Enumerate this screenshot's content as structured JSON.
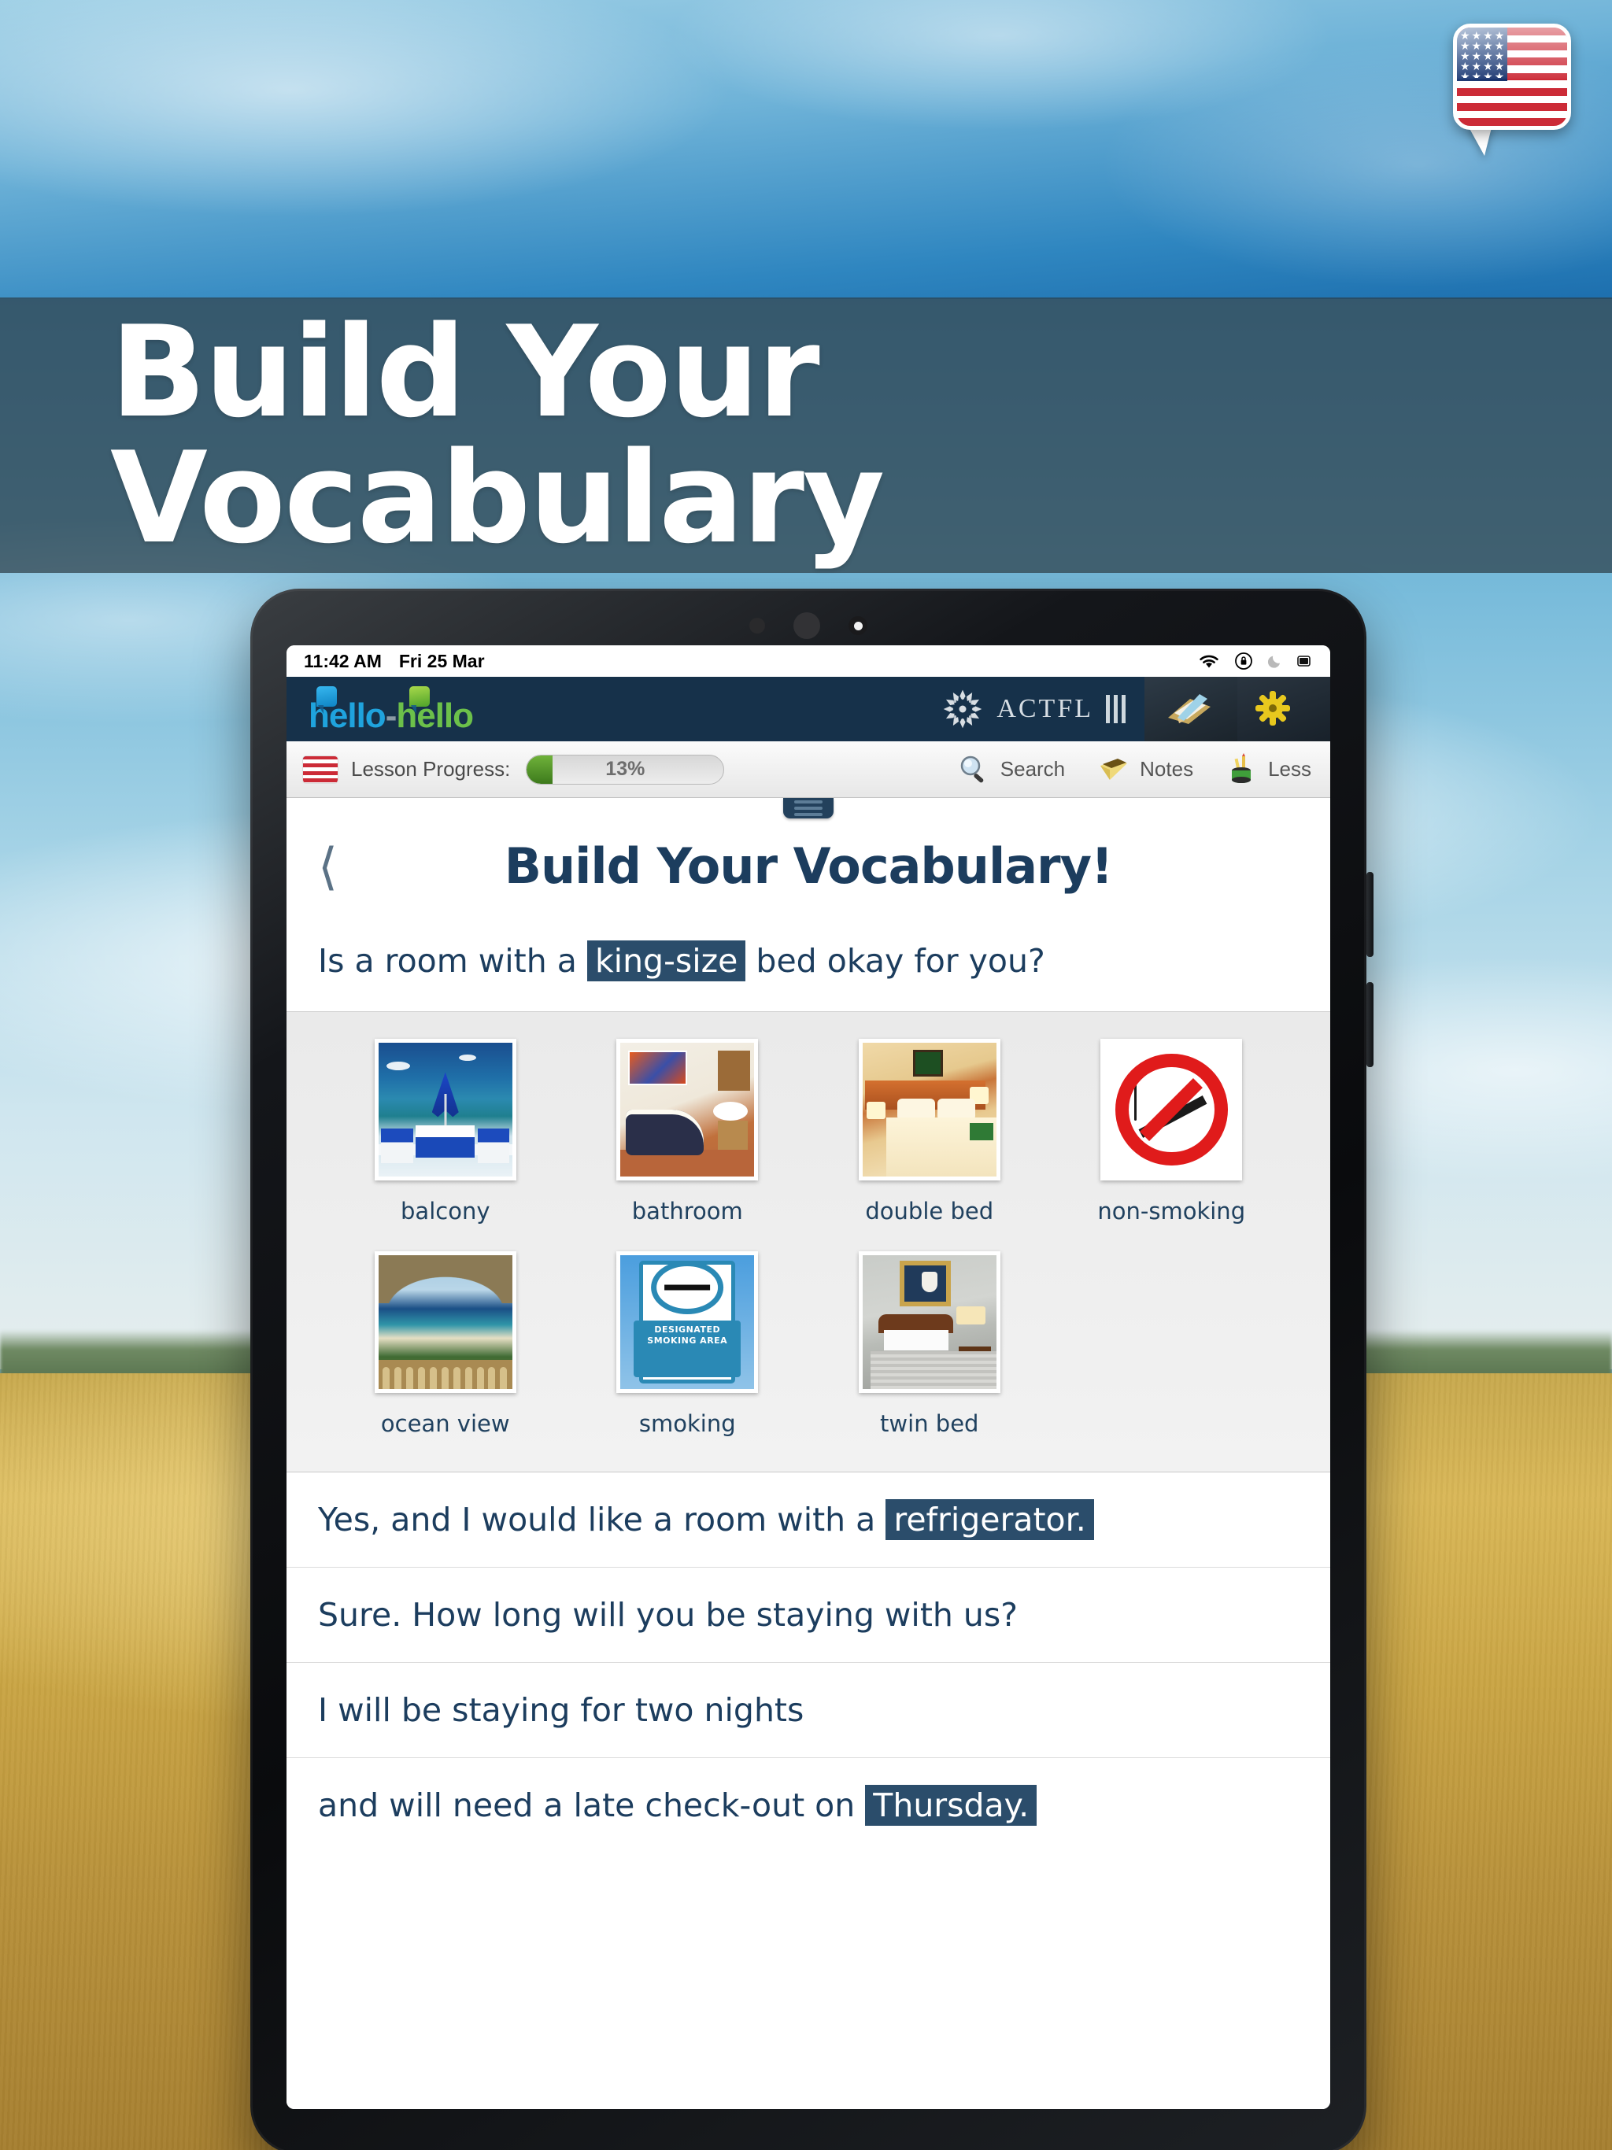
{
  "promo": {
    "headline": "Build Your Vocabulary",
    "flag_badge_icon": "us-flag-speech-bubble-icon"
  },
  "device": {
    "statusbar": {
      "time": "11:42 AM",
      "date": "Fri 25 Mar",
      "icons": [
        "wifi-icon",
        "rotation-lock-icon",
        "do-not-disturb-moon-icon",
        "battery-icon"
      ]
    },
    "header": {
      "logo_part1": "hello",
      "logo_dash": "-",
      "logo_part2": "hello",
      "actfl_label": "ACTFL",
      "actfl_icon": "actfl-mandala-icon",
      "tiles": [
        "notebook-pencil-icon",
        "gear-flower-icon"
      ]
    },
    "toolbar": {
      "flag_icon": "us-flag-icon",
      "progress_label": "Lesson Progress:",
      "progress_value": "13%",
      "progress_percent": 13,
      "items": [
        {
          "label": "Search",
          "icon": "magnifier-icon"
        },
        {
          "label": "Notes",
          "icon": "yellow-notepad-icon"
        },
        {
          "label": "Less",
          "icon": "pencil-cup-icon"
        }
      ]
    },
    "content": {
      "back_icon": "chevron-left-icon",
      "drag_handle_icon": "drag-handle-icon",
      "title": "Build Your Vocabulary!",
      "prompt": {
        "before": "Is a room with a",
        "highlight": "king-size",
        "after": "bed okay for you?"
      },
      "vocab_row1": [
        {
          "label": "balcony",
          "image": "balcony-terrace-sea-photo"
        },
        {
          "label": "bathroom",
          "image": "bathroom-bathtub-photo"
        },
        {
          "label": "double bed",
          "image": "double-bed-hotel-room-photo"
        },
        {
          "label": "non-smoking",
          "image": "no-smoking-sign-photo"
        }
      ],
      "vocab_row2": [
        {
          "label": "ocean view",
          "image": "ocean-view-arch-photo"
        },
        {
          "label": "smoking",
          "image": "designated-smoking-area-sign-photo"
        },
        {
          "label": "twin bed",
          "image": "twin-bed-hotel-room-photo"
        }
      ],
      "smoking_sign_text": "DESIGNATED SMOKING AREA",
      "sentences": [
        {
          "before": "Yes, and I would like a room with a",
          "highlight": "refrigerator.",
          "after": ""
        },
        {
          "before": "Sure. How long will you be staying with us?",
          "highlight": "",
          "after": ""
        },
        {
          "before": "I will be staying for two nights",
          "highlight": "",
          "after": ""
        },
        {
          "before": "and will need a late check-out on",
          "highlight": "Thursday.",
          "after": ""
        }
      ]
    }
  },
  "colors": {
    "navy": "#16314a",
    "text_navy": "#1c3d5e",
    "highlight_bg": "#2b4d6b",
    "progress_green": "#3d7a1c",
    "banner_overlay": "rgba(44,62,72,.72)"
  }
}
